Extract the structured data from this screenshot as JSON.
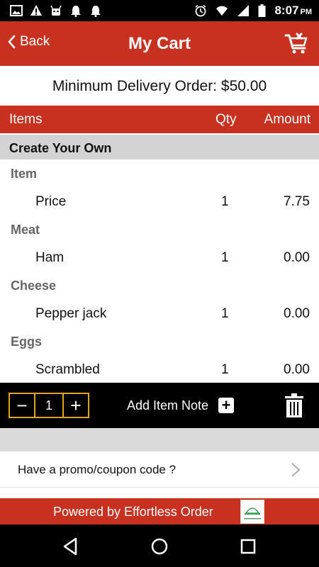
{
  "statusbar": {
    "time": "8:07",
    "ampm": "PM",
    "left_icons": [
      "image-icon",
      "warning-icon",
      "android-icon",
      "bell-icon",
      "bell-icon"
    ],
    "right_icons": [
      "alarm-icon",
      "wifi-icon",
      "signal-icon",
      "battery-icon"
    ]
  },
  "header": {
    "back_label": "Back",
    "title": "My Cart",
    "clear_icon": "cart-remove-icon"
  },
  "min_order": "Minimum Delivery Order: $50.00",
  "table_header": {
    "items": "Items",
    "qty": "Qty",
    "amount": "Amount"
  },
  "section_title": "Create Your Own",
  "groups": [
    {
      "label": "Item",
      "name": "Price",
      "qty": "1",
      "amount": "7.75"
    },
    {
      "label": "Meat",
      "name": "Ham",
      "qty": "1",
      "amount": "0.00"
    },
    {
      "label": "Cheese",
      "name": "Pepper jack",
      "qty": "1",
      "amount": "0.00"
    },
    {
      "label": "Eggs",
      "name": "Scrambled",
      "qty": "1",
      "amount": "0.00"
    }
  ],
  "actions": {
    "minus": "−",
    "quantity": "1",
    "plus": "+",
    "add_note_label": "Add Item Note",
    "add_note_plus": "+"
  },
  "promo": {
    "label": "Have a promo/coupon code ?"
  },
  "footer": {
    "label": "Powered by Effortless Order",
    "logo_text": "Effortless Order"
  },
  "colors": {
    "brand_red": "#c8311f",
    "stepper_border": "#e2a21a",
    "section_gray": "#d3d3d3"
  }
}
